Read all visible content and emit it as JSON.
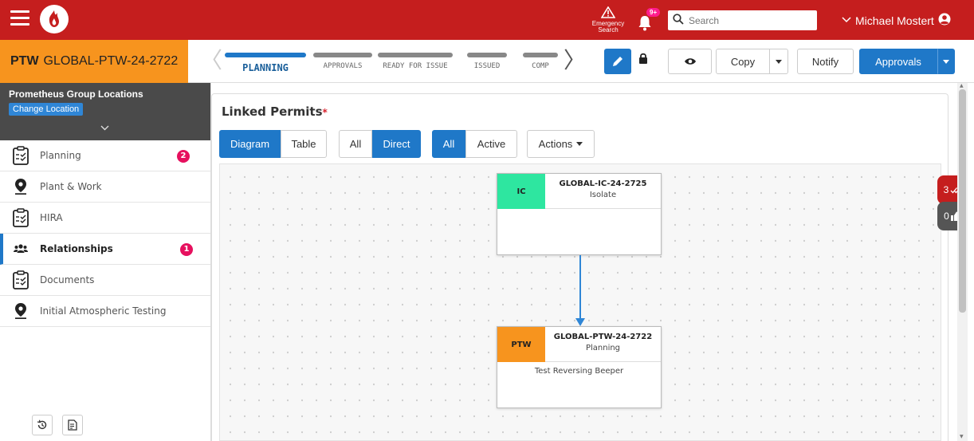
{
  "topbar": {
    "emergency_label": "Emergency\nSearch",
    "emergency_line1": "Emergency",
    "emergency_line2": "Search",
    "notifications_count": "9+",
    "search_placeholder": "Search",
    "user_name": "Michael Mostert",
    "icons": [
      "hamburger-menu-icon",
      "app-logo",
      "warning-icon",
      "bell-icon",
      "search-icon",
      "chevron-down-icon",
      "user-circle-icon"
    ]
  },
  "permit": {
    "type": "PTW",
    "code": "GLOBAL-PTW-24-2722"
  },
  "workflow": {
    "steps": [
      {
        "label": "PLANNING",
        "active": true
      },
      {
        "label": "APPROVALS",
        "active": false
      },
      {
        "label": "READY FOR ISSUE",
        "active": false
      },
      {
        "label": "ISSUED",
        "active": false
      },
      {
        "label": "COMP",
        "active": false
      }
    ]
  },
  "toolbar": {
    "copy_label": "Copy",
    "notify_label": "Notify",
    "approvals_label": "Approvals"
  },
  "sidebar": {
    "location_name": "Prometheus Group Locations",
    "change_location_label": "Change Location",
    "items": [
      {
        "label": "Planning",
        "icon": "clipboard-check-icon",
        "badge": "2",
        "active": false
      },
      {
        "label": "Plant & Work",
        "icon": "map-marker-icon",
        "badge": "",
        "active": false
      },
      {
        "label": "HIRA",
        "icon": "clipboard-check-icon",
        "badge": "",
        "active": false
      },
      {
        "label": "Relationships",
        "icon": "users-icon",
        "badge": "1",
        "active": true
      },
      {
        "label": "Documents",
        "icon": "clipboard-check-icon",
        "badge": "",
        "active": false
      },
      {
        "label": "Initial Atmospheric Testing",
        "icon": "map-marker-icon",
        "badge": "",
        "active": false
      }
    ]
  },
  "main": {
    "title": "Linked Permits",
    "required_marker": "*",
    "view_toggle": [
      "Diagram",
      "Table"
    ],
    "view_selected": "Diagram",
    "scope_toggle": [
      "All",
      "Direct"
    ],
    "scope_selected": "Direct",
    "state_toggle": [
      "All",
      "Active"
    ],
    "state_selected": "All",
    "actions_label": "Actions"
  },
  "diagram": {
    "nodes": [
      {
        "tag": "IC",
        "tag_color": "#2ee6a0",
        "code": "GLOBAL-IC-24-2725",
        "status": "Isolate",
        "description": ""
      },
      {
        "tag": "PTW",
        "tag_color": "#f7941e",
        "code": "GLOBAL-PTW-24-2722",
        "status": "Planning",
        "description": "Test Reversing Beeper"
      }
    ],
    "links": [
      {
        "from": "GLOBAL-IC-24-2725",
        "to": "GLOBAL-PTW-24-2722"
      }
    ]
  },
  "side_tabs": [
    {
      "count": "3",
      "icon": "double-check-icon",
      "color": "#c51e1e"
    },
    {
      "count": "0",
      "icon": "thumbs-up-icon",
      "color": "#555555"
    }
  ],
  "colors": {
    "topbar": "#c51e1e",
    "accent": "#1f78c8",
    "permit_orange": "#f7941e",
    "badge": "#e6105e"
  }
}
